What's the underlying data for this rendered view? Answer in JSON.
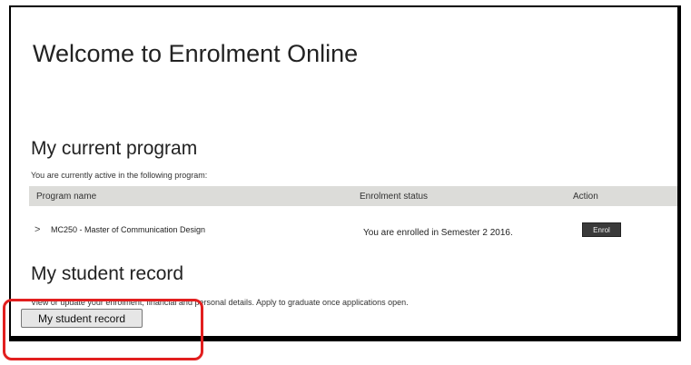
{
  "page": {
    "welcome_title": "Welcome to Enrolment Online"
  },
  "current_program": {
    "heading": "My current program",
    "intro": "You are currently active in the following program:",
    "columns": {
      "program_name": "Program name",
      "enrolment_status": "Enrolment status",
      "action": "Action"
    },
    "rows": [
      {
        "program": "MC250 - Master of Communication Design",
        "status": "You are enrolled in Semester 2 2016.",
        "action_label": "Enrol"
      }
    ]
  },
  "student_record": {
    "heading": "My student record",
    "description": "View or update your enrolment, financial and personal details. Apply to graduate once applications open.",
    "button_label": "My student record"
  },
  "colors": {
    "highlight": "#e21f1f",
    "table_header_bg": "#dcdcd9",
    "enrol_button_bg": "#3a3a3a"
  }
}
